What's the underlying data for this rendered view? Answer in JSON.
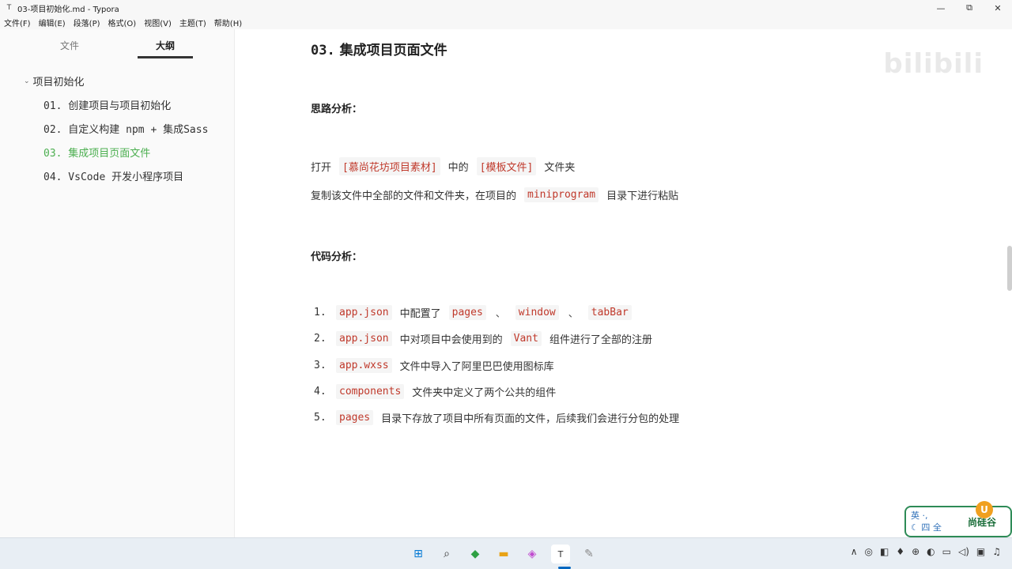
{
  "window": {
    "title": "03-项目初始化.md - Typora",
    "app_icon": "T",
    "minimize_label": "—",
    "restore_label": "⧉",
    "close_label": "✕"
  },
  "menu": [
    "文件(F)",
    "编辑(E)",
    "段落(P)",
    "格式(O)",
    "视图(V)",
    "主题(T)",
    "帮助(H)"
  ],
  "sidebar": {
    "tabs": [
      "文件",
      "大纲"
    ],
    "active_tab": "大纲",
    "outline_root": "项目初始化",
    "items": [
      {
        "label": "01. 创建项目与项目初始化",
        "active": false
      },
      {
        "label": "02. 自定义构建 npm + 集成Sass",
        "active": false
      },
      {
        "label": "03. 集成项目页面文件",
        "active": true
      },
      {
        "label": "04. VsCode 开发小程序项目",
        "active": false
      }
    ],
    "bottom_left": "<",
    "bottom_code": "</>"
  },
  "doc": {
    "h1_num": "03.",
    "h1_text": "集成项目页面文件",
    "section1": "思路分析：",
    "p1": {
      "t1": "打开",
      "c1": "[慕尚花坊项目素材]",
      "t2": "中的",
      "c2": "[模板文件]",
      "t3": "文件夹"
    },
    "p2": {
      "t1": "复制该文件中全部的文件和文件夹，在项目的",
      "c1": "miniprogram",
      "t2": "目录下进行粘贴"
    },
    "section2": "代码分析：",
    "list": [
      {
        "num": "1.",
        "c1": "app.json",
        "t1": "中配置了",
        "c2": "pages",
        "s1": "、",
        "c3": "window",
        "s2": "、",
        "c4": "tabBar"
      },
      {
        "num": "2.",
        "c1": "app.json",
        "t1": "中对项目中会使用到的",
        "c2": "Vant",
        "t2": "组件进行了全部的注册"
      },
      {
        "num": "3.",
        "c1": "app.wxss",
        "t1": "文件中导入了阿里巴巴使用图标库"
      },
      {
        "num": "4.",
        "c1": "components",
        "t1": "文件夹中定义了两个公共的组件"
      },
      {
        "num": "5.",
        "c1": "pages",
        "t1": "目录下存放了项目中所有页面的文件，后续我们会进行分包的处理"
      }
    ]
  },
  "watermark": {
    "bilibili": "bilibili"
  },
  "ime": {
    "line1": "英 ·,",
    "line2": "☾ 四 全",
    "brand": "尚硅谷",
    "badge": "U"
  },
  "taskbar": {
    "apps": [
      "⊞",
      "⌕",
      "◆",
      "▬",
      "◈",
      "T",
      "✎"
    ],
    "tray": [
      "∧",
      "◎",
      "◧",
      "♦",
      "⊕",
      "◐",
      "▭",
      "◁)",
      "▣",
      "♫"
    ]
  },
  "colors": {
    "accent": "#4caf50",
    "code": "#c0392b",
    "taskbar": "#e8eef4"
  }
}
